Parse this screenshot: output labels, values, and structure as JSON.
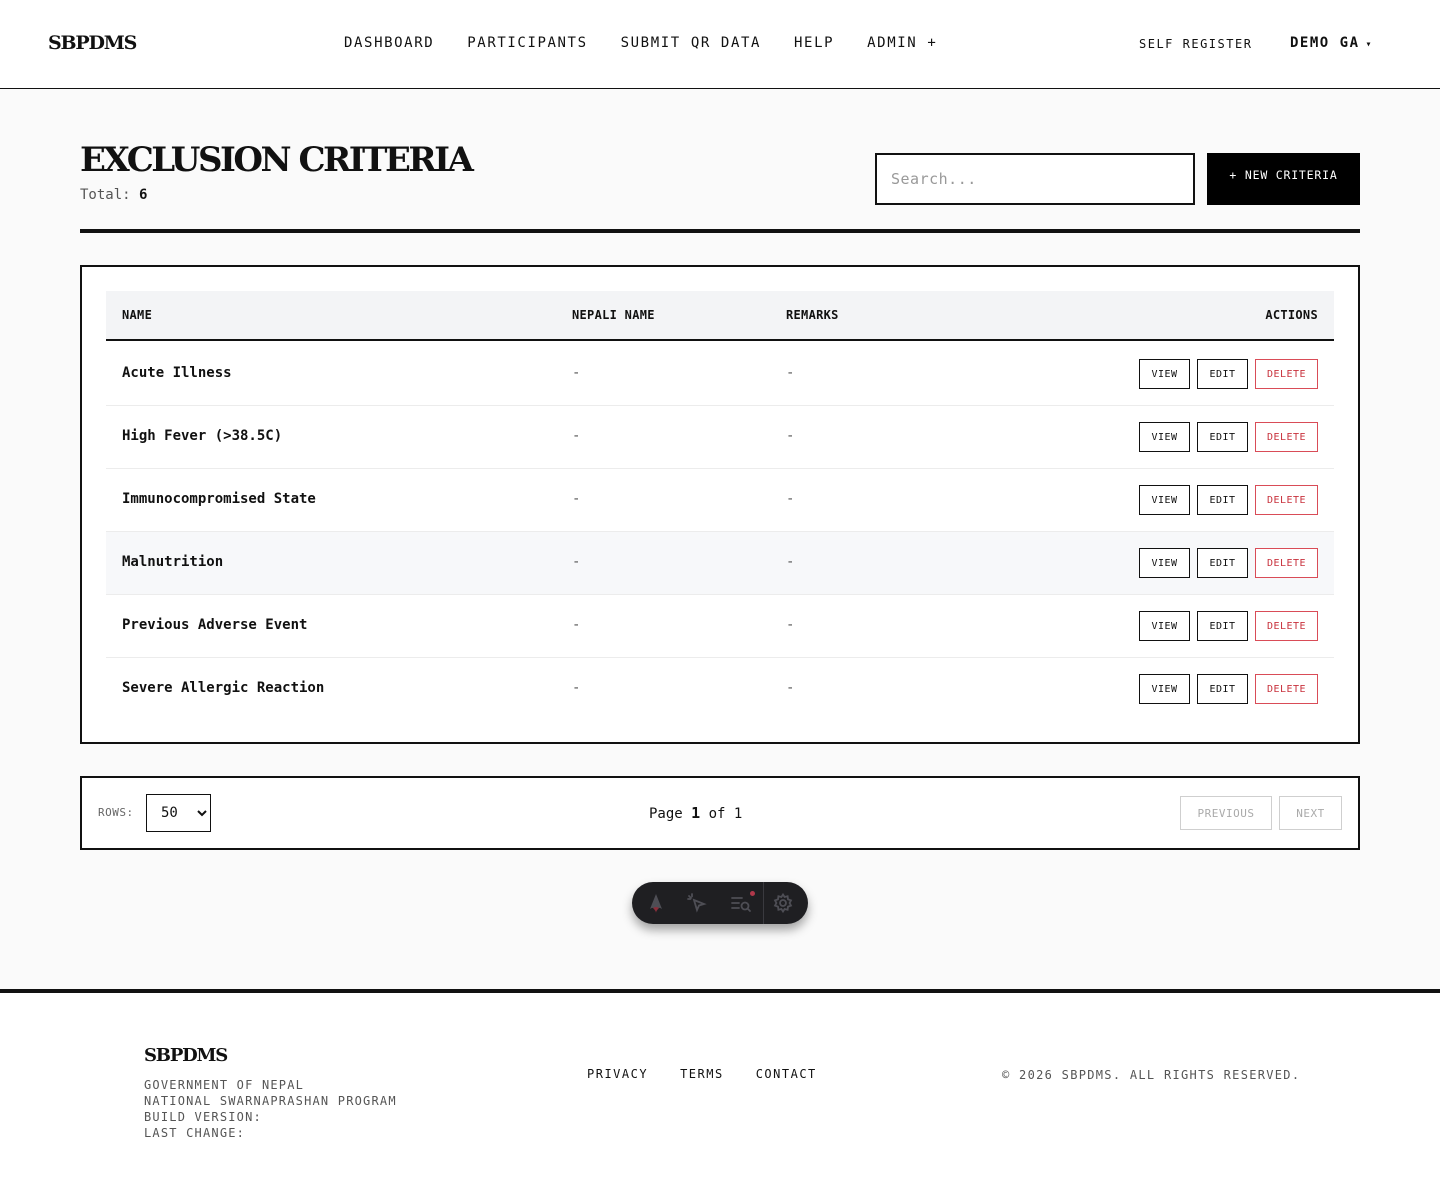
{
  "header": {
    "logo": "SBPDMS",
    "nav": [
      {
        "label": "DASHBOARD"
      },
      {
        "label": "PARTICIPANTS"
      },
      {
        "label": "SUBMIT QR DATA"
      },
      {
        "label": "HELP"
      },
      {
        "label": "ADMIN +"
      }
    ],
    "self_register": "SELF REGISTER",
    "user": "DEMO GA",
    "user_caret": "▾"
  },
  "page": {
    "title": "EXCLUSION CRITERIA",
    "total_label": "Total:",
    "total_value": "6",
    "search_placeholder": "Search...",
    "new_button": "+ NEW CRITERIA"
  },
  "table": {
    "columns": [
      "NAME",
      "NEPALI NAME",
      "REMARKS",
      "ACTIONS"
    ],
    "rows": [
      {
        "name": "Acute Illness",
        "nepali_name": "-",
        "remarks": "-"
      },
      {
        "name": "High Fever (>38.5C)",
        "nepali_name": "-",
        "remarks": "-"
      },
      {
        "name": "Immunocompromised State",
        "nepali_name": "-",
        "remarks": "-"
      },
      {
        "name": "Malnutrition",
        "nepali_name": "-",
        "remarks": "-"
      },
      {
        "name": "Previous Adverse Event",
        "nepali_name": "-",
        "remarks": "-"
      },
      {
        "name": "Severe Allergic Reaction",
        "nepali_name": "-",
        "remarks": "-"
      }
    ],
    "actions": {
      "view": "VIEW",
      "edit": "EDIT",
      "delete": "DELETE"
    }
  },
  "pagination": {
    "rows_label": "ROWS:",
    "rows_value": "50",
    "page_word": "Page",
    "current": "1",
    "of_word": "of",
    "total_pages": "1",
    "previous": "PREVIOUS",
    "next": "NEXT"
  },
  "footer": {
    "logo": "SBPDMS",
    "lines": [
      "GOVERNMENT OF NEPAL",
      "NATIONAL SWARNAPRASHAN PROGRAM",
      "BUILD VERSION:",
      "LAST CHANGE:"
    ],
    "links": [
      "PRIVACY",
      "TERMS",
      "CONTACT"
    ],
    "copyright": "© 2026 SBPDMS. ALL RIGHTS RESERVED."
  },
  "colors": {
    "accent": "#000000",
    "delete": "#c8323d",
    "background": "#fafafa",
    "header_row": "#f3f4f6"
  },
  "icons": [
    "astro-icon",
    "inspect-cursor-icon",
    "audit-search-icon",
    "gear-icon"
  ]
}
